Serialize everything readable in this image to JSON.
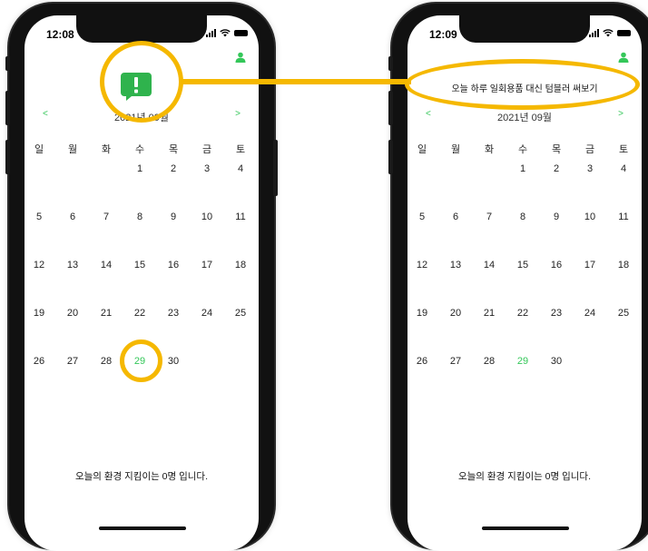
{
  "left_phone": {
    "time": "12:08",
    "month_title": "2021년 09월",
    "prev": "<",
    "next": ">",
    "weekdays": [
      "일",
      "월",
      "화",
      "수",
      "목",
      "금",
      "토"
    ],
    "days": [
      "1",
      "2",
      "3",
      "4",
      "5",
      "6",
      "7",
      "8",
      "9",
      "10",
      "11",
      "12",
      "13",
      "14",
      "15",
      "16",
      "17",
      "18",
      "19",
      "20",
      "21",
      "22",
      "23",
      "24",
      "25",
      "26",
      "27",
      "28",
      "29",
      "30"
    ],
    "bottom_text": "오늘의 환경 지킴이는 0명 입니다."
  },
  "right_phone": {
    "time": "12:09",
    "month_title": "2021년 09월",
    "prev": "<",
    "next": ">",
    "weekdays": [
      "일",
      "월",
      "화",
      "수",
      "목",
      "금",
      "토"
    ],
    "days": [
      "1",
      "2",
      "3",
      "4",
      "5",
      "6",
      "7",
      "8",
      "9",
      "10",
      "11",
      "12",
      "13",
      "14",
      "15",
      "16",
      "17",
      "18",
      "19",
      "20",
      "21",
      "22",
      "23",
      "24",
      "25",
      "26",
      "27",
      "28",
      "29",
      "30"
    ],
    "toast": "오늘 하루 일회용품 대신 텀블러 써보기",
    "bottom_text": "오늘의 환경 지킴이는 0명 입니다."
  },
  "colors": {
    "accent": "#34c759",
    "highlight": "#f5b800"
  },
  "icons": {
    "alert": "exclamation-bubble-icon",
    "profile": "person-icon"
  }
}
